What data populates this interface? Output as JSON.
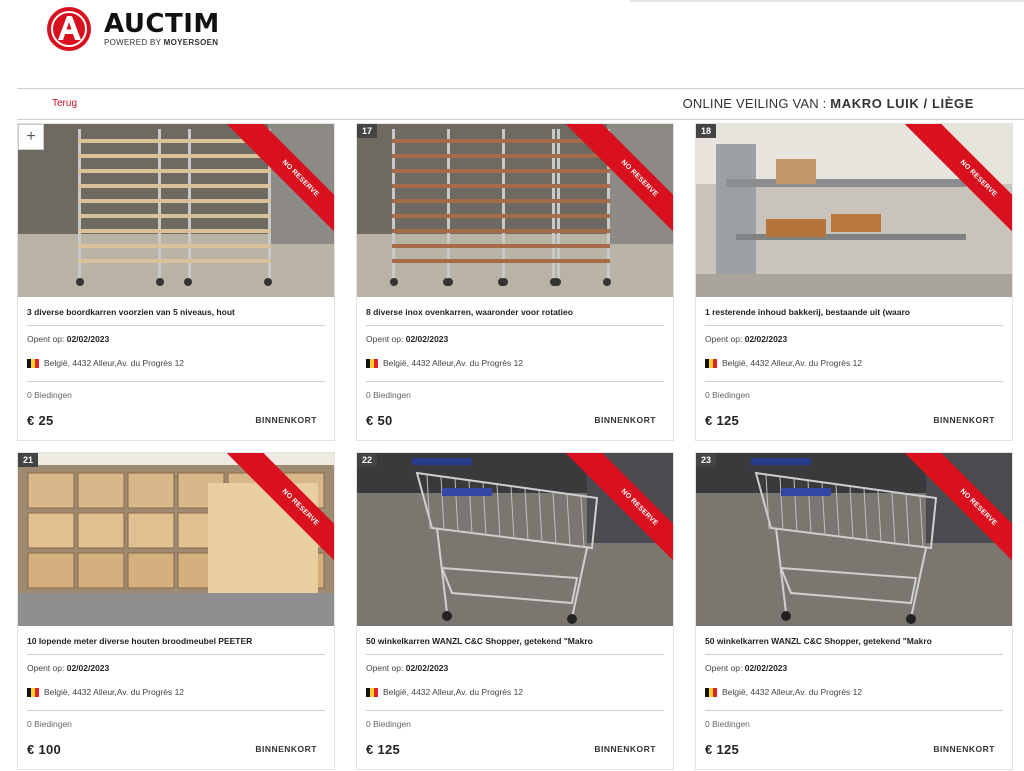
{
  "brand": {
    "name": "AUCTIM",
    "tagline_prefix": "POWERED BY",
    "tagline_company": "MOYERSOEN",
    "color": "#d9111e"
  },
  "header": {
    "back_label": "Terug",
    "title_prefix": "ONLINE VEILING VAN :",
    "title_name": "MAKRO LUIK / LIÈGE"
  },
  "ribbon_label": "NO RESERVE",
  "first_card_button": "+",
  "lots": [
    {
      "number": "",
      "title": "3 diverse boordkarren voorzien van 5 niveaus, hout",
      "opens_label": "Opent op:",
      "opens_date": "02/02/2023",
      "location": "België, 4432 Alleur,Av. du Progrès 12",
      "bids": "0 Biedingen",
      "price": "€ 25",
      "status": "BINNENKORT",
      "photo": "racks-wood"
    },
    {
      "number": "17",
      "title": "8 diverse inox ovenkarren, waaronder voor rotatieo",
      "opens_label": "Opent op:",
      "opens_date": "02/02/2023",
      "location": "België, 4432 Alleur,Av. du Progrès 12",
      "bids": "0 Biedingen",
      "price": "€ 50",
      "status": "BINNENKORT",
      "photo": "racks-inox"
    },
    {
      "number": "18",
      "title": "1 resterende inhoud bakkerij, bestaande uit (waaro",
      "opens_label": "Opent op:",
      "opens_date": "02/02/2023",
      "location": "België, 4432 Alleur,Av. du Progrès 12",
      "bids": "0 Biedingen",
      "price": "€ 125",
      "status": "BINNENKORT",
      "photo": "bakery"
    },
    {
      "number": "21",
      "title": "10 lopende meter diverse houten broodmeubel PEETER",
      "opens_label": "Opent op:",
      "opens_date": "02/02/2023",
      "location": "België, 4432 Alleur,Av. du Progrès 12",
      "bids": "0 Biedingen",
      "price": "€ 100",
      "status": "BINNENKORT",
      "photo": "bread-furniture"
    },
    {
      "number": "22",
      "title": "50 winkelkarren WANZL C&C Shopper, getekend \"Makro",
      "opens_label": "Opent op:",
      "opens_date": "02/02/2023",
      "location": "België, 4432 Alleur,Av. du Progrès 12",
      "bids": "0 Biedingen",
      "price": "€ 125",
      "status": "BINNENKORT",
      "photo": "cart"
    },
    {
      "number": "23",
      "title": "50 winkelkarren WANZL C&C Shopper, getekend \"Makro",
      "opens_label": "Opent op:",
      "opens_date": "02/02/2023",
      "location": "België, 4432 Alleur,Av. du Progrès 12",
      "bids": "0 Biedingen",
      "price": "€ 125",
      "status": "BINNENKORT",
      "photo": "cart"
    }
  ]
}
